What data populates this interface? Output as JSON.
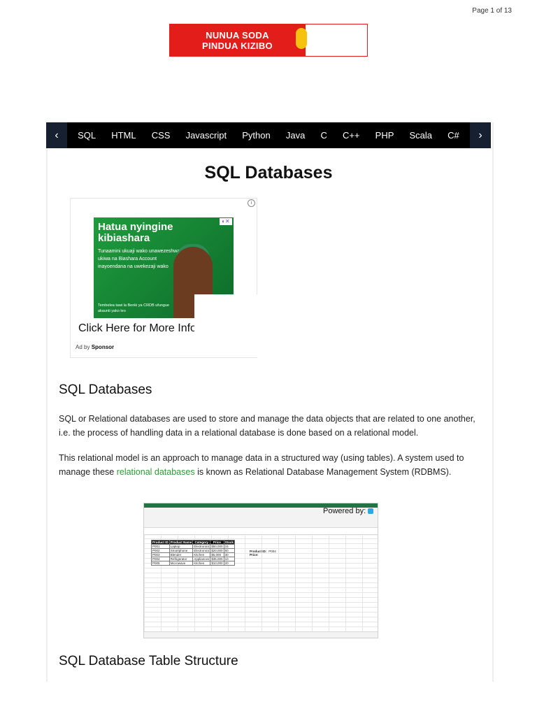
{
  "page_indicator": "Page 1 of 13",
  "top_ad": {
    "line1": "NUNUA SODA",
    "line2": "PINDUA KIZIBO"
  },
  "nav": {
    "prev": "‹",
    "next": "›",
    "items": [
      "SQL",
      "HTML",
      "CSS",
      "Javascript",
      "Python",
      "Java",
      "C",
      "C++",
      "PHP",
      "Scala",
      "C#"
    ]
  },
  "page_title": "SQL Databases",
  "ad": {
    "info": "i",
    "close": "◐✕",
    "headline": "Hatua nyingine kibiashara",
    "body": "Tunaamini ukuaji wako unawezeshwa ukiwa na Biashara Account inayoendana na uwekezaji wako",
    "footer": "Tembelea tawi la Benki ya CRDB ufungue akaunti yako leo",
    "cta": "Click Here for More Info",
    "by_prefix": "Ad by",
    "by_name": "Sponsor"
  },
  "section1": {
    "heading": "SQL Databases",
    "p1": "SQL or Relational databases are used to store and manage the data objects that are related to one another, i.e. the process of handling data in a relational database is done based on a relational model.",
    "p2_before": "This relational model is an approach to manage data in a structured way (using tables). A system used to manage these ",
    "p2_link": "relational databases",
    "p2_after": " is known as Relational Database Management System (RDBMS)."
  },
  "spreadsheet": {
    "headers": [
      "Product ID",
      "Product Name",
      "Category",
      "Price",
      "Stock"
    ],
    "rows": [
      [
        "P001",
        "Laptop",
        "Electronics",
        "$50,000",
        "15"
      ],
      [
        "P002",
        "Smartphone",
        "Electronics",
        "$20,000",
        "50"
      ],
      [
        "P003",
        "Blender",
        "Kitchen",
        "$5,000",
        "30"
      ],
      [
        "P004",
        "Refrigerator",
        "Appliances",
        "$35,000",
        "10"
      ],
      [
        "P005",
        "Microwave",
        "Kitchen",
        "$10,000",
        "20"
      ]
    ],
    "lookup_label1": "Product ID:",
    "lookup_value1": "P004",
    "lookup_label2": "Price:"
  },
  "powered_by": "Powered by:",
  "section2": {
    "heading": "SQL Database Table Structure"
  }
}
